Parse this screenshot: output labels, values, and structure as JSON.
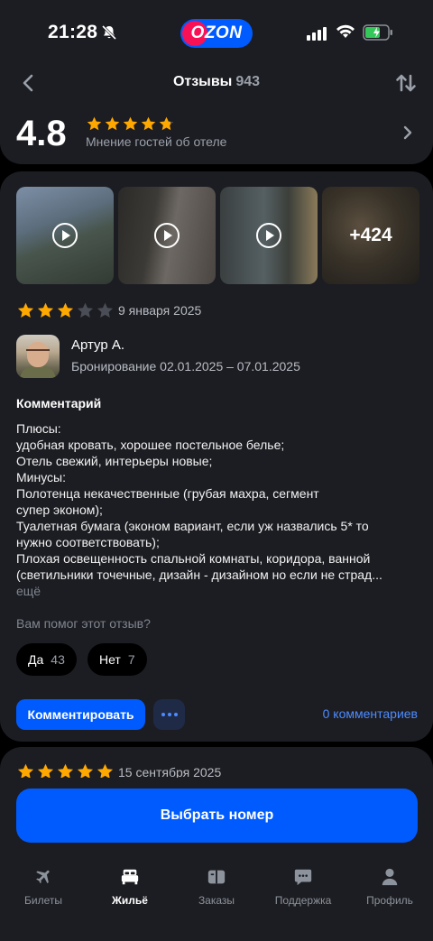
{
  "status_bar": {
    "time": "21:28",
    "brand": "OZON"
  },
  "header": {
    "title": "Отзывы",
    "count": "943"
  },
  "summary": {
    "score": "4.8",
    "stars": 4.8,
    "subtitle": "Мнение гостей об отеле"
  },
  "review": {
    "media_more": "+424",
    "rating": 3,
    "date": "9 января 2025",
    "author": "Артур А.",
    "booking": "Бронирование 02.01.2025 – 07.01.2025",
    "comment_title": "Комментарий",
    "comment_lines": [
      "Плюсы:",
      "удобная кровать, хорошее постельное белье;",
      "Отель свежий, интерьеры новые;",
      "Минусы:",
      "Полотенца некачественные (грубая махра, сегмент",
      "супер эконом);",
      "Туалетная бумага (эконом вариант, если уж назвались 5* то",
      "нужно соответствовать);",
      "Плохая освещенность спальной комнаты, коридора, ванной",
      "(светильники точечные, дизайн - дизайном но если не страд..."
    ],
    "more_link": "ещё",
    "helpful_question": "Вам помог этот отзыв?",
    "yes_label": "Да",
    "yes_count": "43",
    "no_label": "Нет",
    "no_count": "7",
    "comment_button": "Комментировать",
    "comments_count": "0 комментариев"
  },
  "next_review": {
    "rating": 5,
    "date": "15 сентября 2025"
  },
  "cta": {
    "label": "Выбрать номер"
  },
  "tabs": [
    {
      "label": "Билеты",
      "icon": "plane-icon",
      "active": false
    },
    {
      "label": "Жильё",
      "icon": "bed-icon",
      "active": true
    },
    {
      "label": "Заказы",
      "icon": "box-icon",
      "active": false
    },
    {
      "label": "Поддержка",
      "icon": "chat-icon",
      "active": false
    },
    {
      "label": "Профиль",
      "icon": "person-icon",
      "active": false
    }
  ],
  "colors": {
    "accent": "#005bff",
    "star": "#ffa800",
    "star_empty": "#4a4d55",
    "card": "#1c1d22"
  }
}
